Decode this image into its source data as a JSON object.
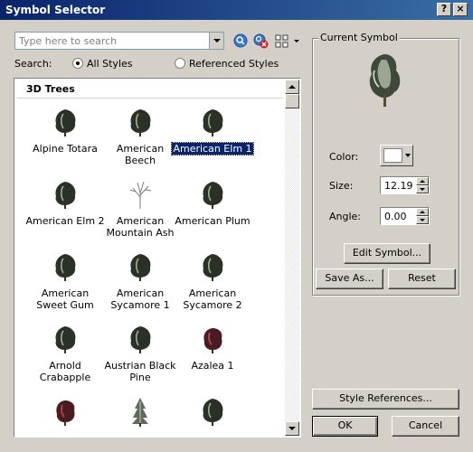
{
  "window": {
    "title": "Symbol Selector",
    "help_glyph": "?",
    "close_glyph": "×"
  },
  "search": {
    "placeholder": "Type here to search",
    "value": "",
    "scope_label": "Search:",
    "options": [
      {
        "label": "All Styles",
        "checked": true
      },
      {
        "label": "Referenced Styles",
        "checked": false
      }
    ],
    "icons": [
      "search-icon",
      "clear-search-icon",
      "view-options-icon"
    ]
  },
  "symbol_list": {
    "category": "3D Trees",
    "selected": "American Elm 1",
    "items": [
      {
        "label": "Alpine Totara",
        "icon": "tree-icon"
      },
      {
        "label": "American Beech",
        "icon": "tree-icon"
      },
      {
        "label": "American Elm 1",
        "icon": "tree-icon"
      },
      {
        "label": "American Elm 2",
        "icon": "tree-icon"
      },
      {
        "label": "American\nMountain Ash",
        "icon": "bare-tree-icon"
      },
      {
        "label": "American Plum",
        "icon": "tree-icon"
      },
      {
        "label": "American\nSweet Gum",
        "icon": "tree-icon"
      },
      {
        "label": "American\nSycamore 1",
        "icon": "tree-icon"
      },
      {
        "label": "American\nSycamore 2",
        "icon": "tree-icon"
      },
      {
        "label": "Arnold\nCrabapple",
        "icon": "tree-icon"
      },
      {
        "label": "Austrian Black\nPine",
        "icon": "tree-icon"
      },
      {
        "label": "Azalea 1",
        "icon": "shrub-icon"
      },
      {
        "label": "",
        "icon": "shrub-icon"
      },
      {
        "label": "",
        "icon": "conifer-icon"
      },
      {
        "label": "",
        "icon": "tree-icon"
      }
    ]
  },
  "current_symbol": {
    "title": "Current Symbol",
    "color_label": "Color:",
    "color_value": "#ffffff",
    "size_label": "Size:",
    "size_value": "12.19",
    "angle_label": "Angle:",
    "angle_value": "0.00",
    "edit_button": "Edit Symbol...",
    "save_as_button": "Save As...",
    "reset_button": "Reset"
  },
  "footer": {
    "style_references_button": "Style References...",
    "ok_button": "OK",
    "cancel_button": "Cancel"
  },
  "colors": {
    "dialog_bg": "#d4d0c8",
    "title_bar": "#0a246a",
    "selection": "#0a246a"
  }
}
